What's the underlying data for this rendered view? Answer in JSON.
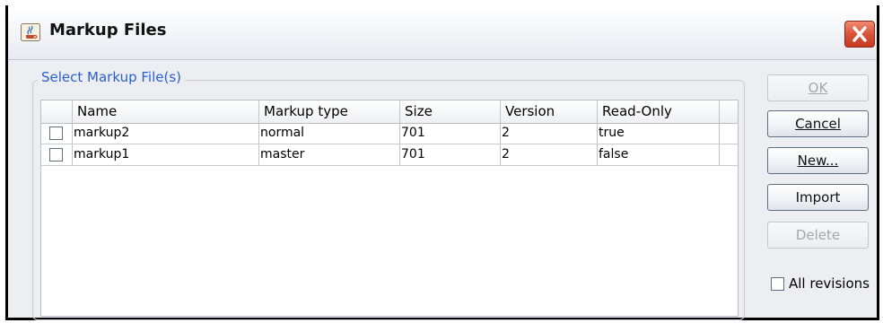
{
  "window": {
    "title": "Markup Files"
  },
  "group": {
    "label": "Select Markup File(s)"
  },
  "table": {
    "columns": [
      "Name",
      "Markup type",
      "Size",
      "Version",
      "Read-Only"
    ],
    "rows": [
      {
        "name": "markup2",
        "type": "normal",
        "size": "701",
        "version": "2",
        "readonly": "true"
      },
      {
        "name": "markup1",
        "type": "master",
        "size": "701",
        "version": "2",
        "readonly": "false"
      }
    ]
  },
  "buttons": {
    "ok": "OK",
    "cancel": "Cancel",
    "new": "New...",
    "import": "Import",
    "delete": "Delete"
  },
  "all_revisions": {
    "label": "All revisions",
    "checked": false
  },
  "colors": {
    "group_label": "#2a5fd0",
    "close_button": "#d9533a"
  },
  "icons": {
    "app": "java-coffee-cup-icon",
    "close": "close-x-icon"
  }
}
